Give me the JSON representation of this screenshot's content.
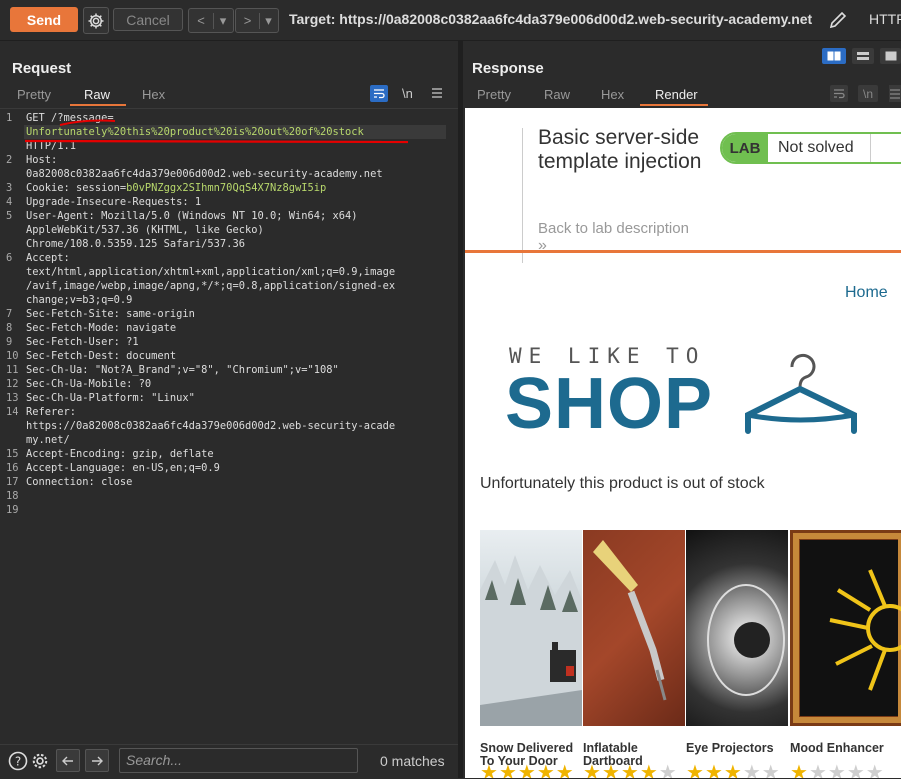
{
  "toolbar": {
    "send_label": "Send",
    "cancel_label": "Cancel",
    "back_label": "<",
    "forward_label": ">",
    "dropdown_glyph": "▾",
    "target": "Target: https://0a82008c0382aa6fc4da379e006d00d2.web-security-academy.net",
    "http_label": "HTTP"
  },
  "request": {
    "title": "Request",
    "tabs": [
      "Pretty",
      "Raw",
      "Hex"
    ],
    "active_tab": "Raw",
    "newline_toggle": "\\n",
    "lines": [
      {
        "n": "1",
        "parts": [
          [
            "k",
            "GET /?message="
          ]
        ]
      },
      {
        "n": "",
        "parts": [
          [
            "g",
            "Unfortunately%20this%20product%20is%20out%20of%20stock"
          ]
        ],
        "hl": true
      },
      {
        "n": "",
        "parts": [
          [
            "k",
            "HTTP/1.1"
          ]
        ]
      },
      {
        "n": "2",
        "parts": [
          [
            "k",
            "Host:"
          ]
        ]
      },
      {
        "n": "",
        "parts": [
          [
            "k",
            "0a82008c0382aa6fc4da379e006d00d2.web-security-academy.net"
          ]
        ]
      },
      {
        "n": "3",
        "parts": [
          [
            "k",
            "Cookie: session="
          ],
          [
            "g",
            "b0vPNZggx2SIhmn70QqS4X7Nz8gwI5ip"
          ]
        ]
      },
      {
        "n": "4",
        "parts": [
          [
            "k",
            "Upgrade-Insecure-Requests: 1"
          ]
        ]
      },
      {
        "n": "5",
        "parts": [
          [
            "k",
            "User-Agent: Mozilla/5.0 (Windows NT 10.0; Win64; x64)"
          ]
        ]
      },
      {
        "n": "",
        "parts": [
          [
            "k",
            "AppleWebKit/537.36 (KHTML, like Gecko)"
          ]
        ]
      },
      {
        "n": "",
        "parts": [
          [
            "k",
            "Chrome/108.0.5359.125 Safari/537.36"
          ]
        ]
      },
      {
        "n": "6",
        "parts": [
          [
            "k",
            "Accept:"
          ]
        ]
      },
      {
        "n": "",
        "parts": [
          [
            "k",
            "text/html,application/xhtml+xml,application/xml;q=0.9,image"
          ]
        ]
      },
      {
        "n": "",
        "parts": [
          [
            "k",
            "/avif,image/webp,image/apng,*/*;q=0.8,application/signed-ex"
          ]
        ]
      },
      {
        "n": "",
        "parts": [
          [
            "k",
            "change;v=b3;q=0.9"
          ]
        ]
      },
      {
        "n": "7",
        "parts": [
          [
            "k",
            "Sec-Fetch-Site: same-origin"
          ]
        ]
      },
      {
        "n": "8",
        "parts": [
          [
            "k",
            "Sec-Fetch-Mode: navigate"
          ]
        ]
      },
      {
        "n": "9",
        "parts": [
          [
            "k",
            "Sec-Fetch-User: ?1"
          ]
        ]
      },
      {
        "n": "10",
        "parts": [
          [
            "k",
            "Sec-Fetch-Dest: document"
          ]
        ]
      },
      {
        "n": "11",
        "parts": [
          [
            "k",
            "Sec-Ch-Ua: \"Not?A_Brand\";v=\"8\", \"Chromium\";v=\"108\""
          ]
        ]
      },
      {
        "n": "12",
        "parts": [
          [
            "k",
            "Sec-Ch-Ua-Mobile: ?0"
          ]
        ]
      },
      {
        "n": "13",
        "parts": [
          [
            "k",
            "Sec-Ch-Ua-Platform: \"Linux\""
          ]
        ]
      },
      {
        "n": "14",
        "parts": [
          [
            "k",
            "Referer:"
          ]
        ]
      },
      {
        "n": "",
        "parts": [
          [
            "k",
            "https://0a82008c0382aa6fc4da379e006d00d2.web-security-acade"
          ]
        ]
      },
      {
        "n": "",
        "parts": [
          [
            "k",
            "my.net/"
          ]
        ]
      },
      {
        "n": "15",
        "parts": [
          [
            "k",
            "Accept-Encoding: gzip, deflate"
          ]
        ]
      },
      {
        "n": "16",
        "parts": [
          [
            "k",
            "Accept-Language: en-US,en;q=0.9"
          ]
        ]
      },
      {
        "n": "17",
        "parts": [
          [
            "k",
            "Connection: close"
          ]
        ]
      },
      {
        "n": "18",
        "parts": []
      },
      {
        "n": "19",
        "parts": []
      }
    ]
  },
  "response": {
    "title": "Response",
    "tabs": [
      "Pretty",
      "Raw",
      "Hex",
      "Render"
    ],
    "active_tab": "Render"
  },
  "render": {
    "lab_title": "Basic server-side template injection",
    "badge_label": "LAB",
    "badge_status": "Not solved",
    "back_link": "Back to lab description",
    "back_chevrons": "»",
    "home_link": "Home",
    "logo_top": "WE LIKE TO",
    "logo_main": "SHOP",
    "message": "Unfortunately this product is out of stock",
    "products": [
      {
        "name": "Snow Delivered To Your Door",
        "rating": 5
      },
      {
        "name": "Inflatable Dartboard",
        "rating": 4
      },
      {
        "name": "Eye Projectors",
        "rating": 3
      },
      {
        "name": "Mood Enhancer",
        "rating": 1
      }
    ]
  },
  "bottom": {
    "search_placeholder": "Search...",
    "matches": "0 matches"
  },
  "colors": {
    "accent": "#e8763a",
    "lab_green": "#70bf50",
    "shop_blue": "#1d6a8f",
    "value_green": "#b8d86c",
    "annotation_red": "#e60000"
  }
}
